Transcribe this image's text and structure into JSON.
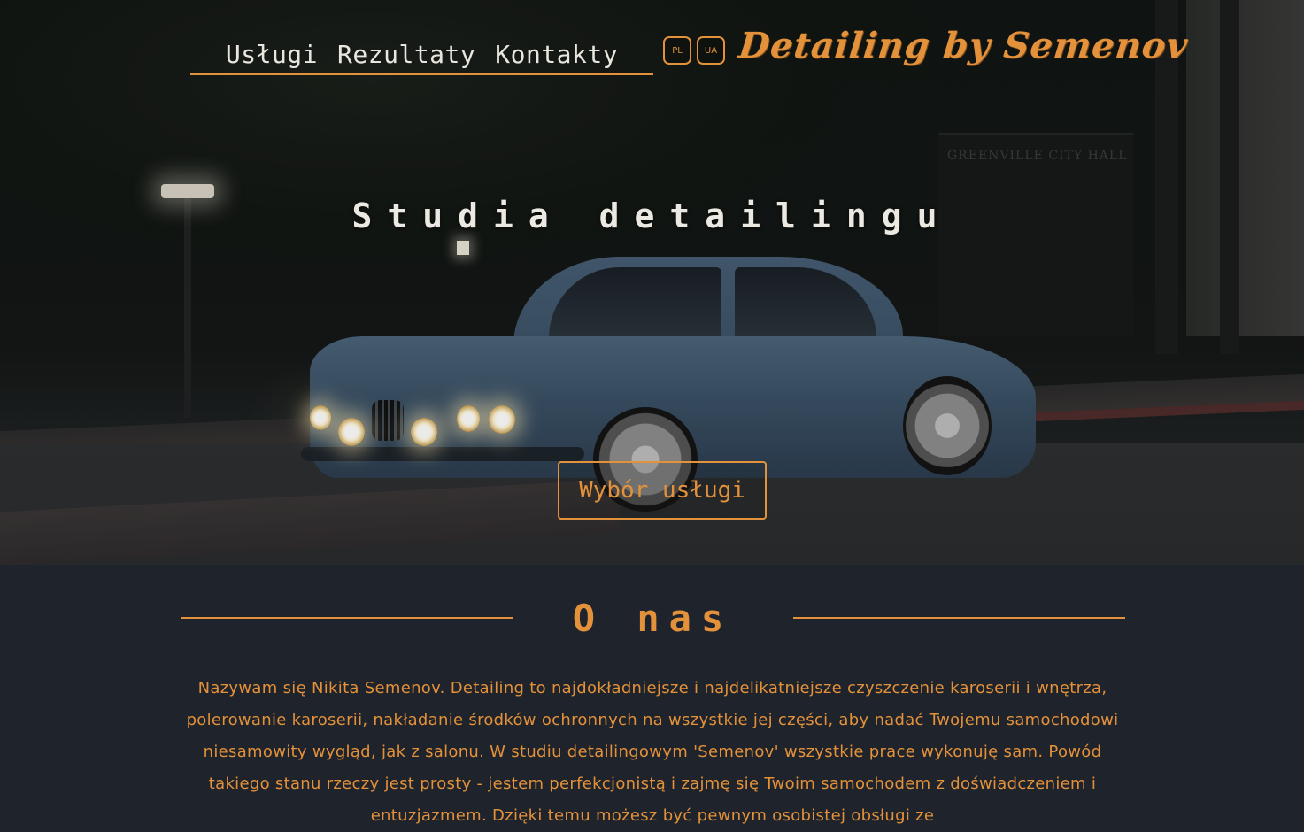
{
  "nav": {
    "links": [
      "Usługi",
      "Rezultaty",
      "Kontakty"
    ]
  },
  "lang": {
    "pl": "PL",
    "ua": "UA"
  },
  "brand": {
    "logo": "Detailing by Semenov"
  },
  "hero": {
    "title": "Studia detailingu",
    "cta": "Wybór usługi"
  },
  "about": {
    "title": "O nas",
    "text": "Nazywam się Nikita Semenov. Detailing to najdokładniejsze i najdelikatniejsze czyszczenie karoserii i wnętrza, polerowanie karoserii, nakładanie środków ochronnych na wszystkie jej części, aby nadać Twojemu samochodowi niesamowity wygląd, jak z salonu. W studiu detailingowym 'Semenov' wszystkie prace wykonuję sam. Powód takiego stanu rzeczy jest prosty - jestem perfekcjonistą i zajmę się Twoim samochodem z doświadczeniem i entuzjazmem. Dzięki temu możesz być pewnym osobistej obsługi ze"
  },
  "colors": {
    "accent": "#e3913a",
    "background": "#1f232b",
    "hero_text": "#ece9e3"
  }
}
